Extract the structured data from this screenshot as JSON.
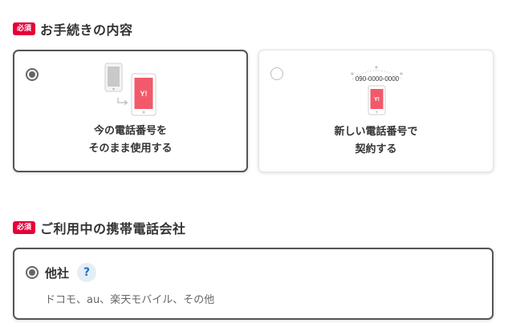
{
  "required_badge": "必須",
  "section1": {
    "title": "お手続きの内容",
    "options": [
      {
        "line1": "今の電話番号を",
        "line2": "そのまま使用する",
        "selected": true,
        "phone_logo": "Y!"
      },
      {
        "line1": "新しい電話番号で",
        "line2": "契約する",
        "selected": false,
        "phone_logo": "Y!",
        "number_label": "090-0000-0000"
      }
    ]
  },
  "section2": {
    "title": "ご利用中の携帯電話会社",
    "option": {
      "label": "他社",
      "help": "?",
      "sub": "ドコモ、au、楽天モバイル、その他",
      "selected": true
    }
  },
  "colors": {
    "badge": "#e60039",
    "phone_red": "#f25a6b",
    "help_blue": "#1a73c8"
  }
}
